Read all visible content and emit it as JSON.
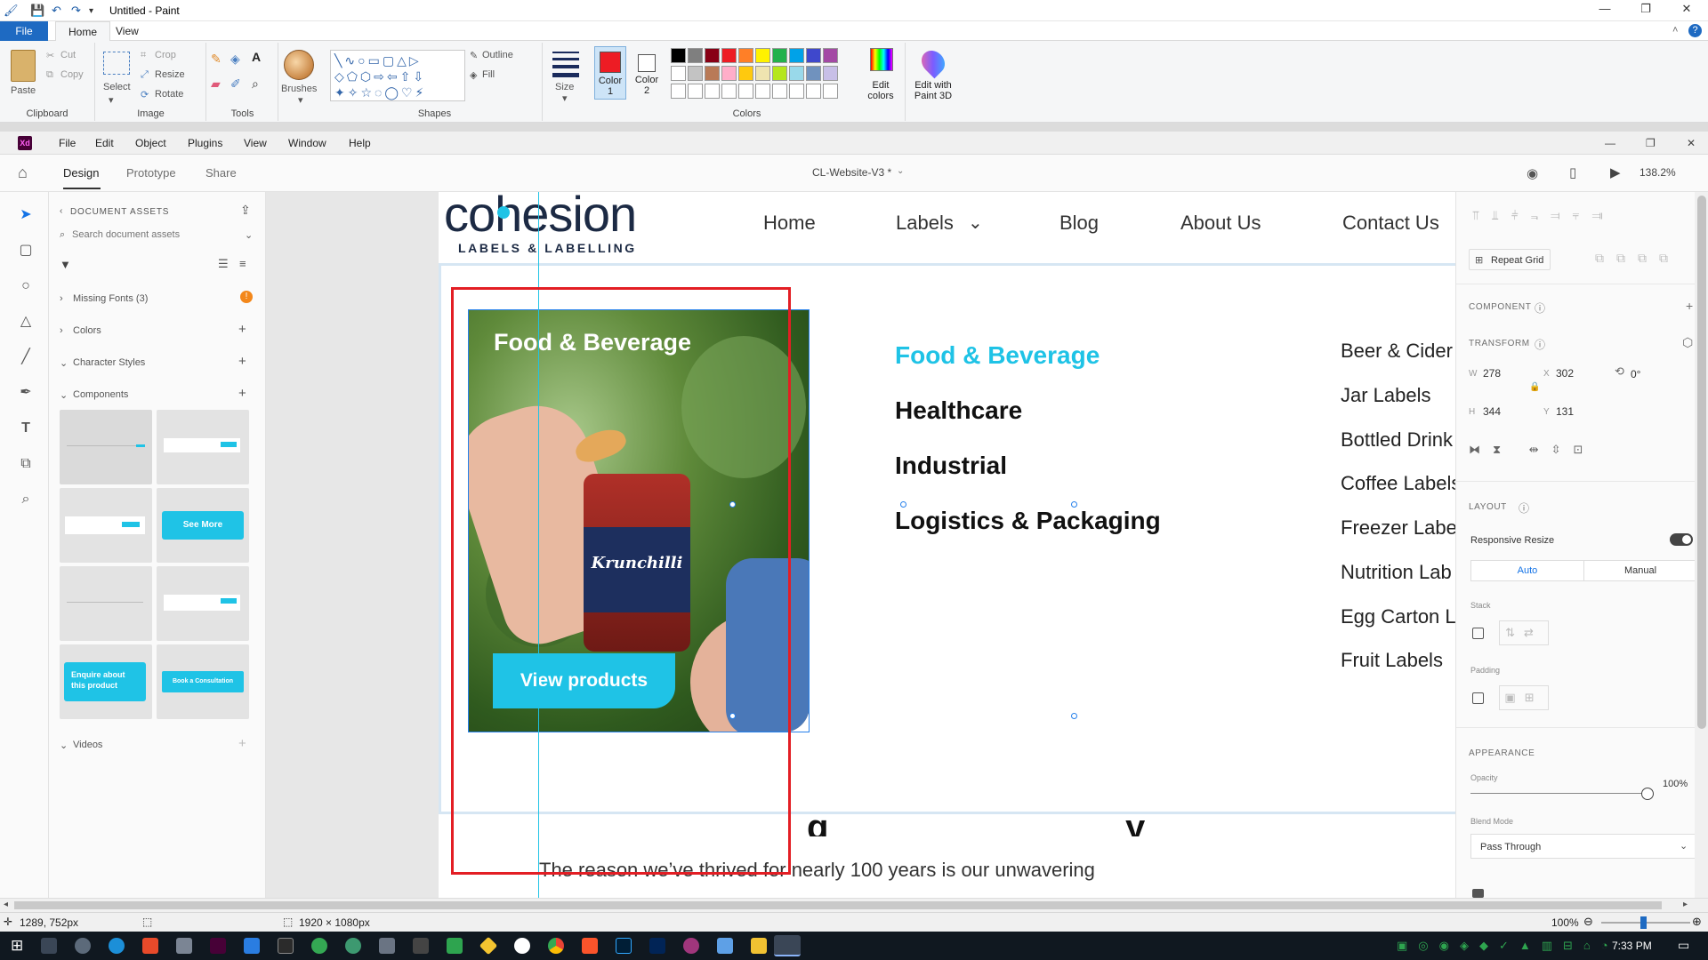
{
  "paint": {
    "window_title": "Untitled - Paint",
    "tabs": [
      "File",
      "Home",
      "View"
    ],
    "clipboard": {
      "paste": "Paste",
      "cut": "Cut",
      "copy": "Copy",
      "label": "Clipboard"
    },
    "image": {
      "select": "Select",
      "crop": "Crop",
      "resize": "Resize",
      "rotate": "Rotate",
      "label": "Image"
    },
    "tools_label": "Tools",
    "brushes": "Brushes",
    "shapes": {
      "outline": "Outline",
      "fill": "Fill",
      "label": "Shapes"
    },
    "size": "Size",
    "color1": "Color\n1",
    "color1_line1": "Color",
    "color1_line2": "1",
    "color2_line1": "Color",
    "color2_line2": "2",
    "edit_colors_line1": "Edit",
    "edit_colors_line2": "colors",
    "paint3d_line1": "Edit with",
    "paint3d_line2": "Paint 3D",
    "colors_label": "Colors",
    "palette_row1": [
      "#000000",
      "#7f7f7f",
      "#880015",
      "#ed1c24",
      "#ff7f27",
      "#fff200",
      "#22b14c",
      "#00a2e8",
      "#3f48cc",
      "#a349a4"
    ],
    "palette_row2": [
      "#ffffff",
      "#c3c3c3",
      "#b97a57",
      "#ffaec9",
      "#ffc90e",
      "#efe4b0",
      "#b5e61d",
      "#99d9ea",
      "#7092be",
      "#c8bfe7"
    ],
    "status_pos": "1289, 752px",
    "status_size": "1920 × 1080px",
    "zoom": "100%"
  },
  "xd": {
    "menu": [
      "File",
      "Edit",
      "Object",
      "Plugins",
      "View",
      "Window",
      "Help"
    ],
    "modes": [
      "Design",
      "Prototype",
      "Share"
    ],
    "doc_title": "CL-Website-V3 *",
    "zoom": "138.2%",
    "assets": {
      "header": "DOCUMENT ASSETS",
      "search_placeholder": "Search document assets",
      "missing_fonts": "Missing Fonts (3)",
      "colors": "Colors",
      "character_styles": "Character Styles",
      "components": "Components",
      "videos": "Videos",
      "tile_see_more": "See More",
      "tile_enquire": "Enquire about this product",
      "tile_book": "Book a Consultation"
    },
    "right": {
      "repeat_grid": "Repeat Grid",
      "component": "COMPONENT",
      "transform": "TRANSFORM",
      "w_label": "W",
      "w": "278",
      "x_label": "X",
      "x": "302",
      "rotation": "0°",
      "h_label": "H",
      "h": "344",
      "y_label": "Y",
      "y": "131",
      "layout": "LAYOUT",
      "responsive_resize": "Responsive Resize",
      "auto": "Auto",
      "manual": "Manual",
      "stack": "Stack",
      "padding": "Padding",
      "appearance": "APPEARANCE",
      "opacity": "Opacity",
      "opacity_value": "100%",
      "blend_mode": "Blend Mode",
      "blend_value": "Pass Through"
    },
    "site": {
      "logo": "cohesion",
      "logo_sub": "LABELS & LABELLING",
      "nav": [
        "Home",
        "Labels",
        "Blog",
        "About Us",
        "Contact Us"
      ],
      "card_title": "Food & Beverage",
      "card_button": "View products",
      "jar_brand": "Krunchilli",
      "mega_col1": [
        "Food & Beverage",
        "Healthcare",
        "Industrial",
        "Logistics & Packaging"
      ],
      "mega_col2": [
        "Beer & Cider",
        "Jar Labels",
        "Bottled Drink",
        "Coffee Labels",
        "Freezer Label",
        "Nutrition Lab",
        "Egg Carton L",
        "Fruit Labels"
      ],
      "body_text": "The reason we’ve thrived for nearly 100 years is our unwavering"
    }
  },
  "taskbar": {
    "clock": "7:33 PM"
  }
}
